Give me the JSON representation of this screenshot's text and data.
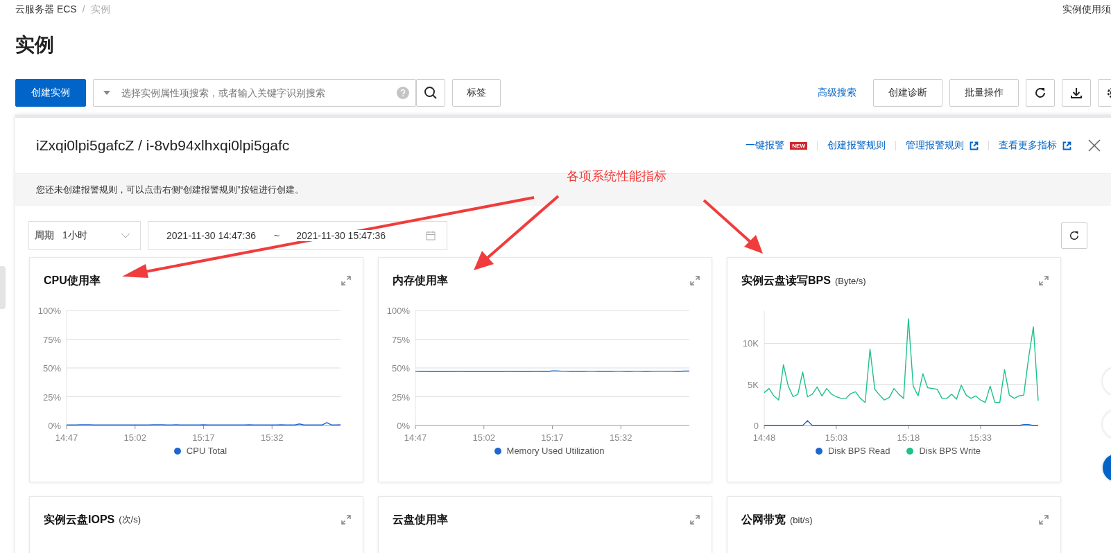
{
  "breadcrumb": [
    {
      "label": "云服务器 ECS"
    },
    {
      "label": "实例"
    }
  ],
  "breadcrumb_separator": "/",
  "top_link": "实例使用须",
  "page_title": "实例",
  "toolbar": {
    "create_button": "创建实例",
    "search": {
      "placeholder": "选择实例属性项搜索，或者输入关键字识别搜索"
    },
    "tag_button": "标签",
    "advanced_search": "高级搜索",
    "buttons": [
      "创建诊断",
      "批量操作"
    ]
  },
  "panel": {
    "title": "iZxqi0lpi5gafcZ / i-8vb94xlhxqi0lpi5gafc",
    "links": [
      {
        "label": "一键报警",
        "badge": "NEW",
        "external": false
      },
      {
        "label": "创建报警规则",
        "external": false
      },
      {
        "label": "管理报警规则",
        "external": true
      },
      {
        "label": "查看更多指标",
        "external": true
      }
    ],
    "notice": "您还未创建报警规则，可以点击右侧“创建报警规则”按钮进行创建。",
    "period": {
      "label": "周期",
      "value": "1小时"
    },
    "range": {
      "start": "2021-11-30 14:47:36",
      "separator": "~",
      "end": "2021-11-30 15:47:36"
    }
  },
  "annotation": {
    "text": "各项系统性能指标"
  },
  "charts": [
    {
      "title": "CPU使用率",
      "chart_data": {
        "type": "line",
        "grid": true,
        "legend": "bottom",
        "categories": [
          "14:47",
          null,
          null,
          null,
          null,
          null,
          null,
          null,
          null,
          null,
          null,
          null,
          null,
          null,
          null,
          "15:02",
          null,
          null,
          null,
          null,
          null,
          null,
          null,
          null,
          null,
          null,
          null,
          null,
          null,
          null,
          "15:17",
          null,
          null,
          null,
          null,
          null,
          null,
          null,
          null,
          null,
          null,
          null,
          null,
          null,
          null,
          "15:32",
          null,
          null,
          null,
          null,
          null,
          null,
          null,
          null,
          null,
          null,
          null,
          null,
          null,
          null,
          null
        ],
        "ylim": [
          0,
          100
        ],
        "yticks": [
          {
            "value": 0,
            "label": "0%"
          },
          {
            "value": 25,
            "label": "25%"
          },
          {
            "value": 50,
            "label": "50%"
          },
          {
            "value": 75,
            "label": "75%"
          },
          {
            "value": 100,
            "label": "100%"
          }
        ],
        "series": [
          {
            "name": "CPU Total",
            "color": "#1f66d0",
            "values": [
              0.4,
              0.5,
              0.5,
              0.6,
              0.6,
              0.6,
              0.5,
              0.4,
              0.4,
              0.5,
              0.5,
              0.4,
              0.4,
              0.5,
              0.5,
              0.4,
              0.4,
              0.5,
              0.5,
              0.6,
              0.6,
              0.6,
              0.5,
              0.5,
              0.6,
              0.5,
              0.4,
              0.5,
              0.5,
              0.5,
              0.6,
              0.4,
              0.4,
              0.5,
              0.5,
              0.5,
              0.4,
              0.4,
              0.5,
              0.5,
              0.6,
              0.5,
              0.5,
              0.5,
              0.5,
              0.5,
              0.5,
              0.6,
              0.5,
              0.5,
              0.5,
              1.3,
              0.5,
              0.5,
              0.5,
              0.5,
              0.5,
              2.5,
              0.5,
              0.5,
              0.6
            ]
          }
        ]
      }
    },
    {
      "title": "内存使用率",
      "chart_data": {
        "type": "line",
        "grid": true,
        "legend": "bottom",
        "categories": [
          "14:47",
          null,
          null,
          null,
          null,
          null,
          null,
          null,
          null,
          null,
          null,
          null,
          null,
          null,
          null,
          "15:02",
          null,
          null,
          null,
          null,
          null,
          null,
          null,
          null,
          null,
          null,
          null,
          null,
          null,
          null,
          "15:17",
          null,
          null,
          null,
          null,
          null,
          null,
          null,
          null,
          null,
          null,
          null,
          null,
          null,
          null,
          "15:32",
          null,
          null,
          null,
          null,
          null,
          null,
          null,
          null,
          null,
          null,
          null,
          null,
          null,
          null,
          null
        ],
        "ylim": [
          0,
          100
        ],
        "yticks": [
          {
            "value": 0,
            "label": "0%"
          },
          {
            "value": 25,
            "label": "25%"
          },
          {
            "value": 50,
            "label": "50%"
          },
          {
            "value": 75,
            "label": "75%"
          },
          {
            "value": 100,
            "label": "100%"
          }
        ],
        "series": [
          {
            "name": "Memory Used Utilization",
            "color": "#1f66d0",
            "values": [
              47.2,
              47.1,
              47.1,
              47.0,
              47.0,
              47.0,
              47.0,
              47.0,
              47.0,
              47.1,
              47.1,
              47.0,
              47.0,
              47.0,
              47.0,
              47.0,
              47.0,
              47.0,
              47.0,
              47.0,
              47.1,
              47.1,
              47.0,
              47.0,
              47.0,
              47.0,
              47.1,
              47.1,
              47.0,
              47.0,
              47.4,
              47.4,
              47.2,
              47.2,
              47.1,
              47.1,
              47.1,
              47.1,
              47.2,
              47.2,
              47.1,
              47.1,
              47.1,
              47.1,
              47.2,
              47.2,
              47.1,
              47.1,
              47.2,
              47.2,
              47.1,
              47.1,
              47.2,
              47.2,
              47.2,
              47.2,
              47.2,
              47.1,
              47.1,
              47.3,
              47.3
            ]
          }
        ]
      }
    },
    {
      "title": "实例云盘读写BPS",
      "unit": "(Byte/s)",
      "chart_data": {
        "type": "line",
        "grid": true,
        "legend": "bottom",
        "categories": [
          "14:48",
          null,
          null,
          null,
          null,
          null,
          null,
          null,
          null,
          null,
          null,
          null,
          null,
          null,
          null,
          "15:03",
          null,
          null,
          null,
          null,
          null,
          null,
          null,
          null,
          null,
          null,
          null,
          null,
          null,
          null,
          "15:18",
          null,
          null,
          null,
          null,
          null,
          null,
          null,
          null,
          null,
          null,
          null,
          null,
          null,
          null,
          "15:33",
          null,
          null,
          null,
          null,
          null,
          null,
          null,
          null,
          null,
          null,
          null,
          null
        ],
        "ylim": [
          0,
          14000
        ],
        "yticks": [
          {
            "value": 0,
            "label": "0"
          },
          {
            "value": 5000,
            "label": "5K"
          },
          {
            "value": 10000,
            "label": "10K"
          }
        ],
        "series": [
          {
            "name": "Disk BPS Read",
            "color": "#1f66d0",
            "values": [
              0,
              0,
              0,
              0,
              0,
              0,
              0,
              0,
              0,
              600,
              0,
              0,
              0,
              0,
              0,
              0,
              0,
              0,
              0,
              0,
              0,
              0,
              0,
              0,
              0,
              0,
              0,
              0,
              0,
              0,
              0,
              0,
              0,
              0,
              0,
              0,
              0,
              0,
              0,
              0,
              0,
              0,
              0,
              0,
              0,
              0,
              0,
              0,
              0,
              0,
              0,
              0,
              0,
              0,
              100,
              100,
              0,
              0
            ]
          },
          {
            "name": "Disk BPS Write",
            "color": "#1fc08e",
            "values": [
              4000,
              4500,
              3600,
              3100,
              7400,
              4800,
              3500,
              3800,
              6500,
              3500,
              3800,
              4700,
              3600,
              4500,
              3800,
              3500,
              3300,
              3300,
              3900,
              4100,
              3300,
              2800,
              9300,
              4400,
              3700,
              3100,
              3400,
              4500,
              3800,
              3300,
              13000,
              4800,
              3600,
              6300,
              4600,
              4500,
              4400,
              3300,
              3300,
              3800,
              3200,
              4900,
              3700,
              3300,
              3600,
              3100,
              2800,
              4800,
              2800,
              2800,
              6800,
              3700,
              3300,
              3600,
              3700,
              8200,
              12000,
              3000
            ]
          }
        ]
      }
    }
  ],
  "charts_more": [
    {
      "title": "实例云盘IOPS",
      "unit": "(次/s)"
    },
    {
      "title": "云盘使用率"
    },
    {
      "title": "公网带宽",
      "unit": "(bit/s)"
    }
  ]
}
